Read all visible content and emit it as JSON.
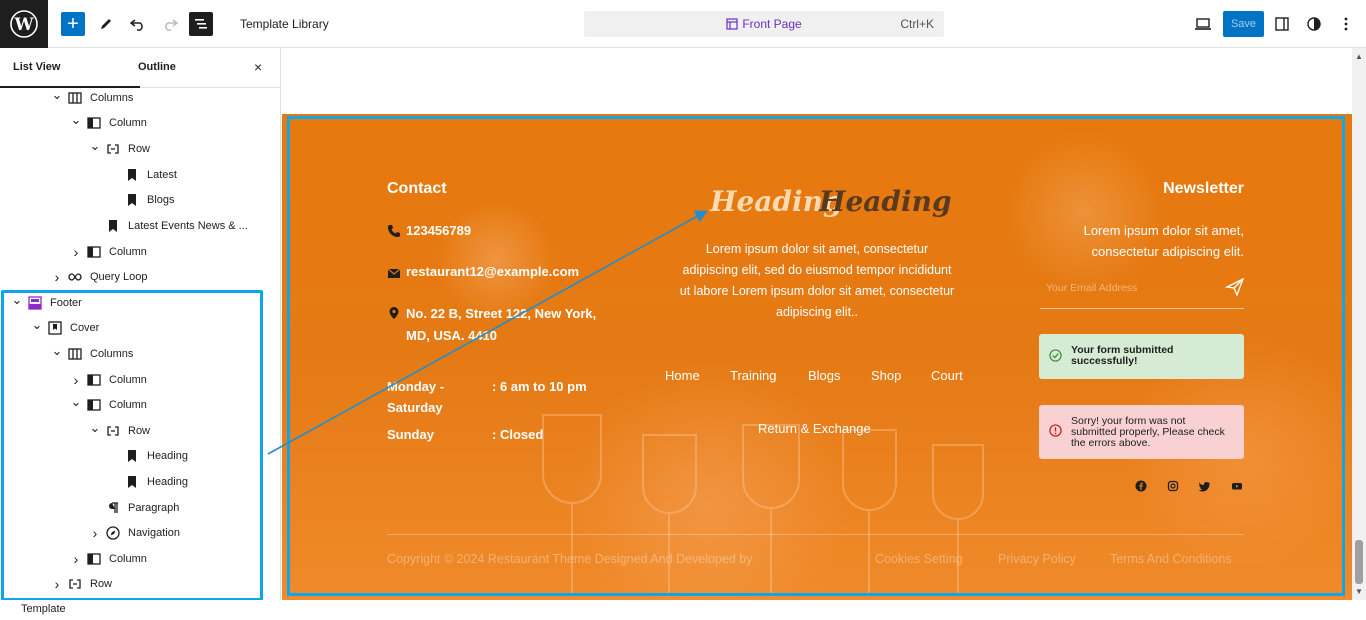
{
  "toolbar": {
    "doc_title": "Template Library",
    "command_bar_page": "Front Page",
    "command_bar_shortcut": "Ctrl+K",
    "save_label": "Save"
  },
  "sidebar": {
    "tab_list_view": "List View",
    "tab_outline": "Outline",
    "close_glyph": "×",
    "tree": [
      {
        "label": "Columns",
        "icon": "columns-icon"
      },
      {
        "label": "Column",
        "icon": "column-icon"
      },
      {
        "label": "Row",
        "icon": "row-icon"
      },
      {
        "label": "Latest",
        "icon": "heading-bookmark-icon"
      },
      {
        "label": "Blogs",
        "icon": "heading-bookmark-icon"
      },
      {
        "label": "Latest Events News & ...",
        "icon": "heading-bookmark-icon"
      },
      {
        "label": "Column",
        "icon": "column-icon"
      },
      {
        "label": "Query Loop",
        "icon": "loop-icon"
      },
      {
        "label": "Footer",
        "icon": "template-part-icon"
      },
      {
        "label": "Cover",
        "icon": "cover-icon"
      },
      {
        "label": "Columns",
        "icon": "columns-icon"
      },
      {
        "label": "Column",
        "icon": "column-icon"
      },
      {
        "label": "Column",
        "icon": "column-icon"
      },
      {
        "label": "Row",
        "icon": "row-icon"
      },
      {
        "label": "Heading",
        "icon": "heading-bookmark-icon"
      },
      {
        "label": "Heading",
        "icon": "heading-bookmark-icon"
      },
      {
        "label": "Paragraph",
        "icon": "paragraph-icon"
      },
      {
        "label": "Navigation",
        "icon": "compass-icon"
      },
      {
        "label": "Column",
        "icon": "column-icon"
      },
      {
        "label": "Row",
        "icon": "row-icon"
      }
    ]
  },
  "breadcrumb": "Template",
  "footer": {
    "contact_heading": "Contact",
    "phone": "123456789",
    "email": "restaurant12@example.com",
    "address_line1": "No. 22 B, Street 122, New York,",
    "address_line2": "MD, USA. 4410",
    "hours": [
      {
        "day_line1": "Monday -",
        "day_line2": "Saturday",
        "time": ": 6 am to 10 pm"
      },
      {
        "day_line1": "Sunday",
        "day_line2": "",
        "time": ": Closed"
      }
    ],
    "heading_a": "Heading",
    "heading_b": "Heading",
    "center_paragraph": "Lorem ipsum dolor sit amet, consectetur adipiscing elit, sed do eiusmod tempor incididunt ut labore Lorem ipsum dolor sit amet, consectetur adipiscing elit..",
    "nav_items": [
      "Home",
      "Training",
      "Blogs",
      "Shop",
      "Court"
    ],
    "nav_item_second_row": "Return & Exchange",
    "newsletter_heading": "Newsletter",
    "newsletter_line1": "Lorem ipsum dolor sit amet,",
    "newsletter_line2": "consectetur adipiscing elit.",
    "email_placeholder": "Your Email Address",
    "success_line1": "Your form submitted",
    "success_line2": "successfully!",
    "error_line1": "Sorry! your form was not",
    "error_line2": "submitted properly, Please check",
    "error_line3": "the errors above.",
    "copyright": "Copyright © 2024 Restaurant Theme Designed And Developed by",
    "bottom_links": [
      "Cookies Setting",
      "Privacy Policy",
      "Terms And Conditions"
    ]
  },
  "colors": {
    "accent_blue": "#0073c5",
    "selection_blue": "#0ea5ec",
    "footer_orange": "#e7780c",
    "heading_a_color": "#ffd9b0",
    "heading_b_color": "#5a3a1e"
  }
}
